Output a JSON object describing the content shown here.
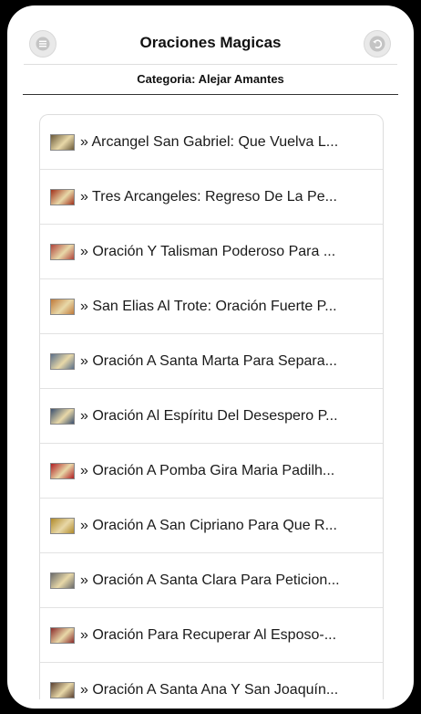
{
  "header": {
    "title": "Oraciones Magicas",
    "menu_icon": "hamburger-menu-icon",
    "back_icon": "back-arrow-icon"
  },
  "subheader": {
    "category": "Categoria: Alejar Amantes"
  },
  "list": {
    "items": [
      {
        "label": "» Arcangel San Gabriel: Que Vuelva L...",
        "color": "#6b5a3a"
      },
      {
        "label": "» Tres Arcangeles: Regreso De La Pe...",
        "color": "#a0301a"
      },
      {
        "label": "» Oración Y Talisman Poderoso Para ...",
        "color": "#b0443c"
      },
      {
        "label": "» San Elias Al Trote: Oración Fuerte P...",
        "color": "#c07a3a"
      },
      {
        "label": "» Oración A Santa Marta Para Separa...",
        "color": "#5a6f8a"
      },
      {
        "label": "» Oración Al Espíritu Del Desespero P...",
        "color": "#3a4f6e"
      },
      {
        "label": "» Oración A Pomba Gira Maria Padilh...",
        "color": "#b01e22"
      },
      {
        "label": "» Oración A San Cipriano Para Que R...",
        "color": "#b08a2a"
      },
      {
        "label": "» Oración A Santa Clara Para Peticion...",
        "color": "#6a6a6a"
      },
      {
        "label": "» Oración Para Recuperar Al Esposo-...",
        "color": "#8a2a2a"
      },
      {
        "label": "» Oración A Santa Ana Y San Joaquín...",
        "color": "#5a4030"
      }
    ]
  }
}
